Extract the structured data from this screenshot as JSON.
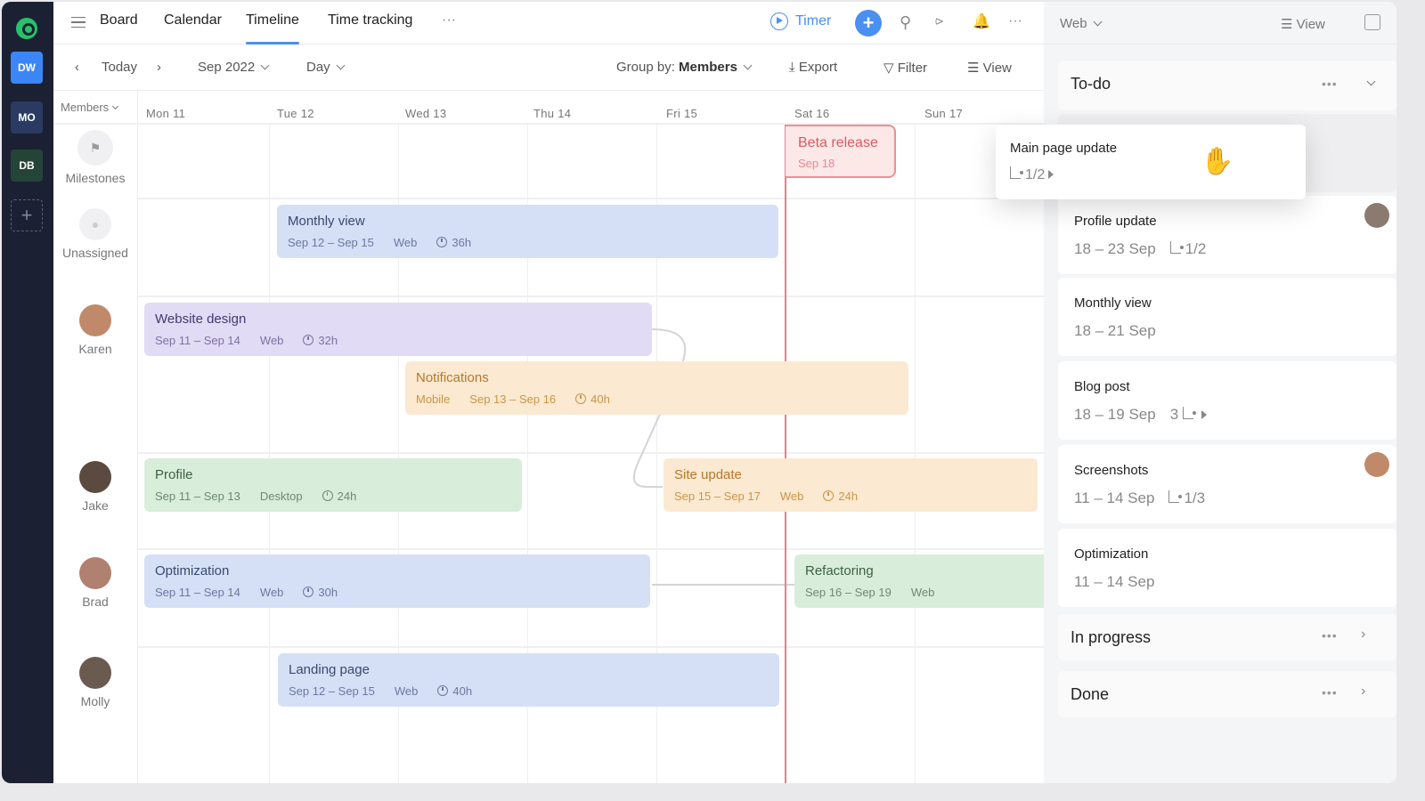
{
  "rail": {
    "workspaces": [
      {
        "label": "DW",
        "color": "#3b86f7"
      },
      {
        "label": "MO",
        "color": "#2a3b63"
      },
      {
        "label": "DB",
        "color": "#254438"
      }
    ],
    "add_label": "+"
  },
  "nav": {
    "tabs": [
      "Board",
      "Calendar",
      "Timeline",
      "Time tracking"
    ],
    "active_tab": "Timeline",
    "more": "···",
    "timer_label": "Timer",
    "add": "+"
  },
  "toolbar": {
    "today": "Today",
    "month": "Sep 2022",
    "scale": "Day",
    "group_by_prefix": "Group by:",
    "group_by_value": "Members",
    "export": "Export",
    "filter": "Filter",
    "view": "View"
  },
  "grid": {
    "members_header": "Members",
    "days": [
      "Mon 11",
      "Tue 12",
      "Wed 13",
      "Thu 14",
      "Fri 15",
      "Sat 16",
      "Sun 17"
    ],
    "rows": [
      {
        "name": "Milestones",
        "type": "icon"
      },
      {
        "name": "Unassigned",
        "type": "icon"
      },
      {
        "name": "Karen",
        "avatar": "#c08a6a"
      },
      {
        "name": "Jake",
        "avatar": "#5a4a40"
      },
      {
        "name": "Brad",
        "avatar": "#b08070"
      },
      {
        "name": "Molly",
        "avatar": "#6b5a50"
      }
    ],
    "milestone": {
      "title": "Beta release",
      "date": "Sep 18"
    },
    "tasks": [
      {
        "title": "Monthly view",
        "dates": "Sep 12 –  Sep 15",
        "tag": "Web",
        "hours": "36h",
        "color": "blue"
      },
      {
        "title": "Website design",
        "dates": "Sep 11 –  Sep 14",
        "tag": "Web",
        "hours": "32h",
        "color": "purple"
      },
      {
        "title": "Notifications",
        "tag": "Mobile",
        "dates": "Sep 13 –  Sep 16",
        "hours": "40h",
        "color": "orange"
      },
      {
        "title": "Profile",
        "dates": "Sep 11 –  Sep 13",
        "tag": "Desktop",
        "hours": "24h",
        "color": "green"
      },
      {
        "title": "Site update",
        "dates": "Sep 15 –  Sep 17",
        "tag": "Web",
        "hours": "24h",
        "color": "orange"
      },
      {
        "title": "Optimization",
        "dates": "Sep 11 –  Sep 14",
        "tag": "Web",
        "hours": "30h",
        "color": "blue"
      },
      {
        "title": "Refactoring",
        "dates": "Sep 16 –  Sep 19",
        "tag": "Web",
        "hours": "",
        "color": "green"
      },
      {
        "title": "Landing page",
        "dates": "Sep 12 –  Sep 15",
        "tag": "Web",
        "hours": "40h",
        "color": "blue"
      }
    ]
  },
  "panel": {
    "filter": "Web",
    "view": "View",
    "groups": [
      {
        "title": "To-do",
        "dots": "•••"
      },
      {
        "title": "In progress",
        "dots": "•••"
      },
      {
        "title": "Done",
        "dots": "•••"
      }
    ],
    "dragging": {
      "title": "Main page update",
      "subtasks": "1/2"
    },
    "cards": [
      {
        "title": "Profile update",
        "dates": "18 – 23 Sep",
        "subtasks": "1/2"
      },
      {
        "title": "Monthly view",
        "dates": "18 – 21 Sep"
      },
      {
        "title": "Blog post",
        "dates": "18 – 19 Sep",
        "subtasks": "3"
      },
      {
        "title": "Screenshots",
        "dates": "11 – 14 Sep",
        "subtasks": "1/3"
      },
      {
        "title": "Optimization",
        "dates": "11 – 14 Sep"
      }
    ]
  }
}
